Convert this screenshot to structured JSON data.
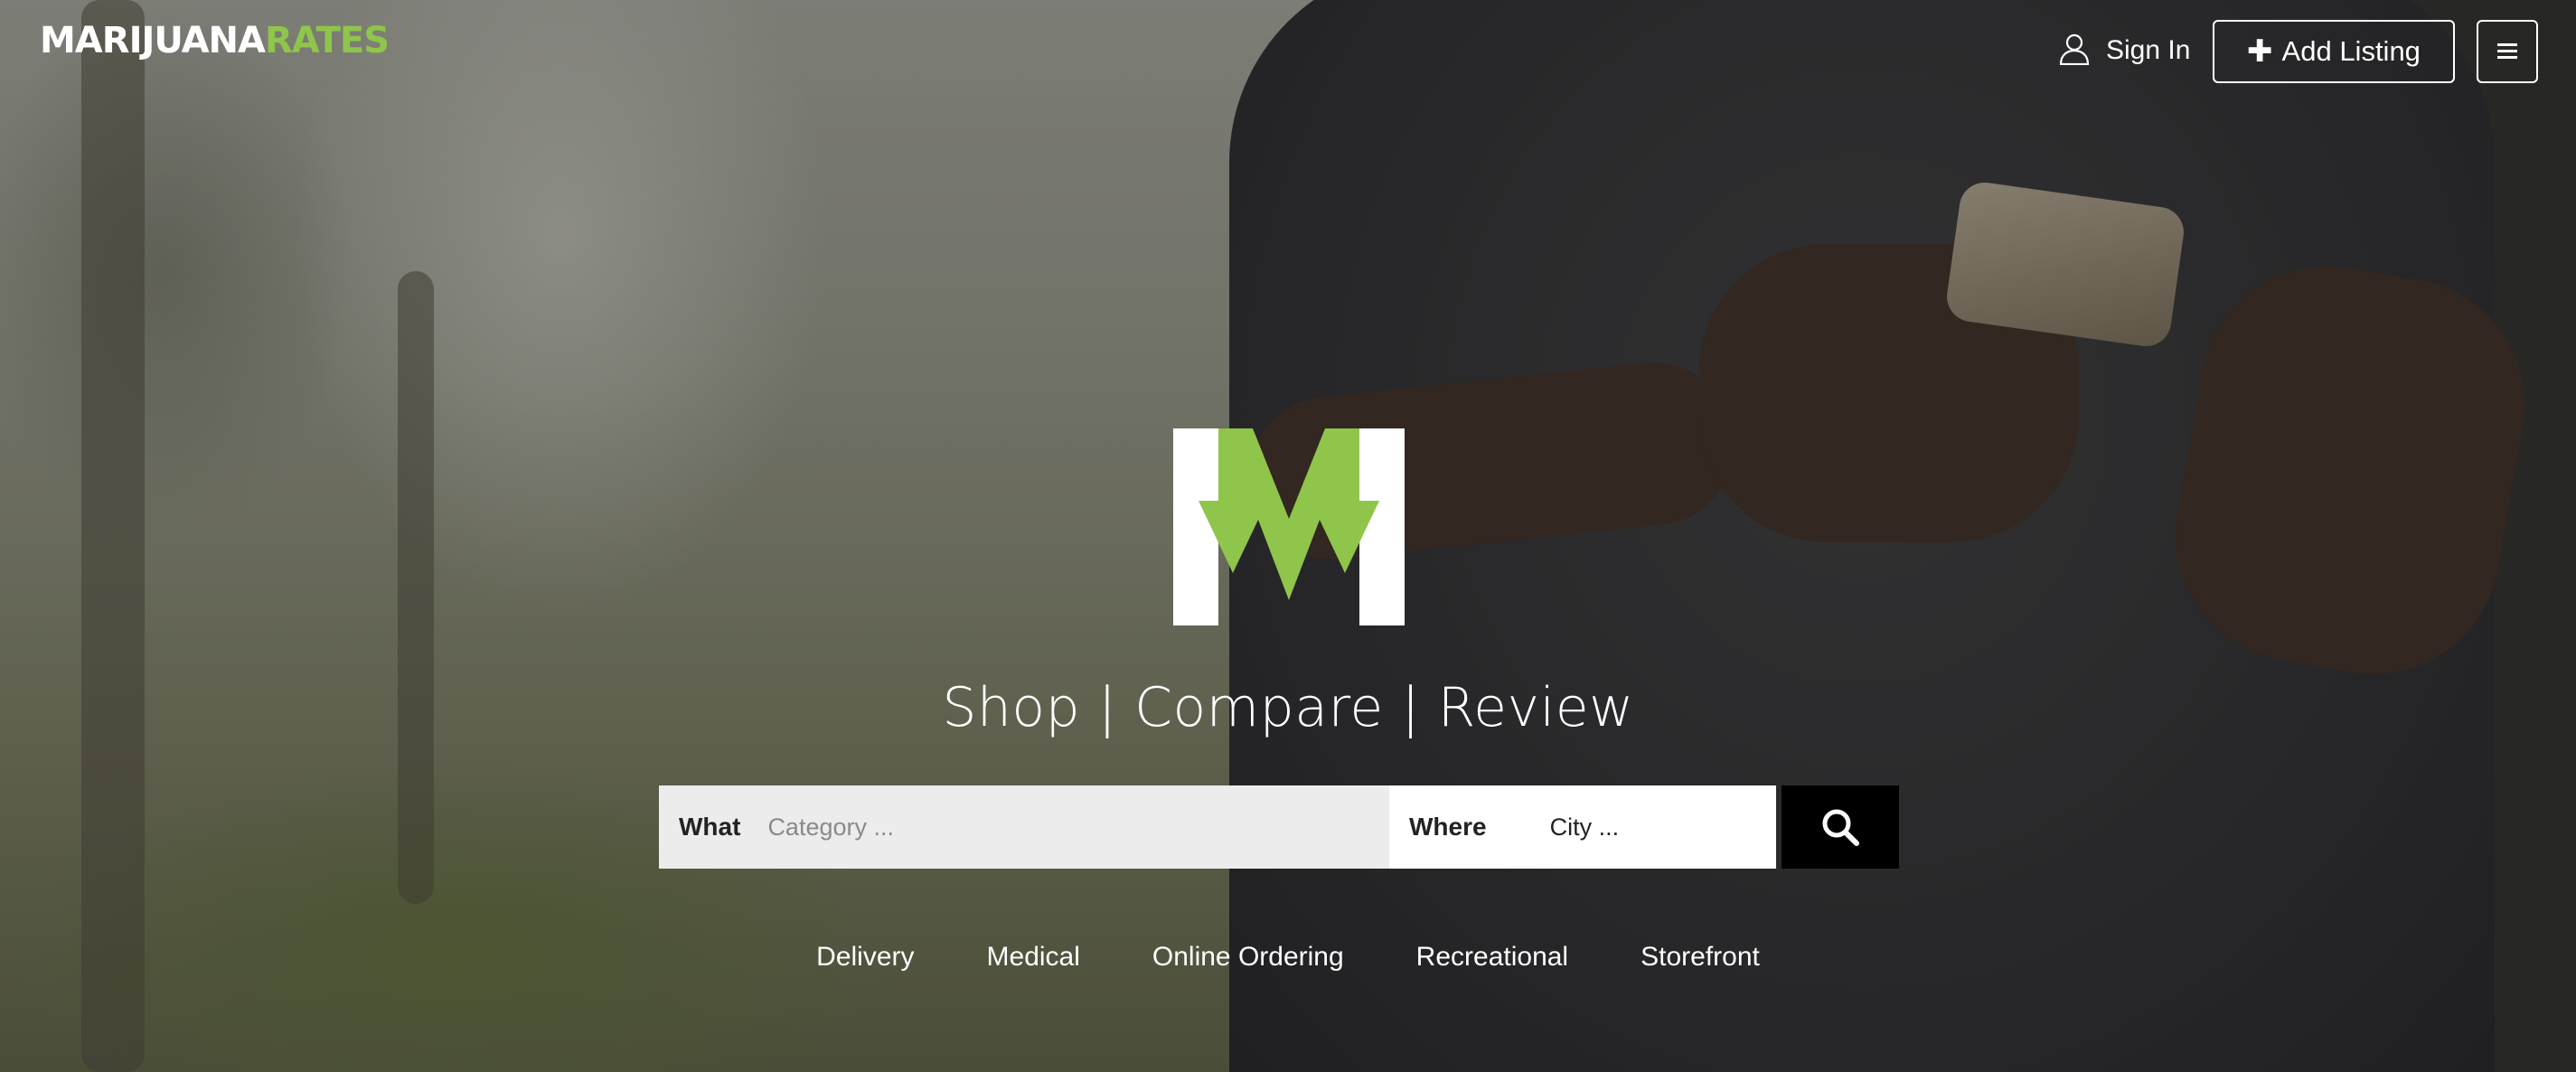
{
  "header": {
    "logo_left": "MARIJUANA",
    "logo_right": "RATES",
    "signin_label": "Sign In",
    "add_listing_label": "Add Listing"
  },
  "hero": {
    "tagline": "Shop | Compare | Review"
  },
  "search": {
    "what_label": "What",
    "what_placeholder": "Category ...",
    "where_label": "Where",
    "where_placeholder": "City ..."
  },
  "categories": [
    "Delivery",
    "Medical",
    "Online Ordering",
    "Recreational",
    "Storefront"
  ],
  "colors": {
    "accent": "#8fc54a",
    "search_button": "#000000",
    "what_field_bg": "#ececec"
  },
  "icons": {
    "signin": "user-icon",
    "add": "plus-icon",
    "menu": "hamburger-menu-icon",
    "search": "search-icon"
  }
}
